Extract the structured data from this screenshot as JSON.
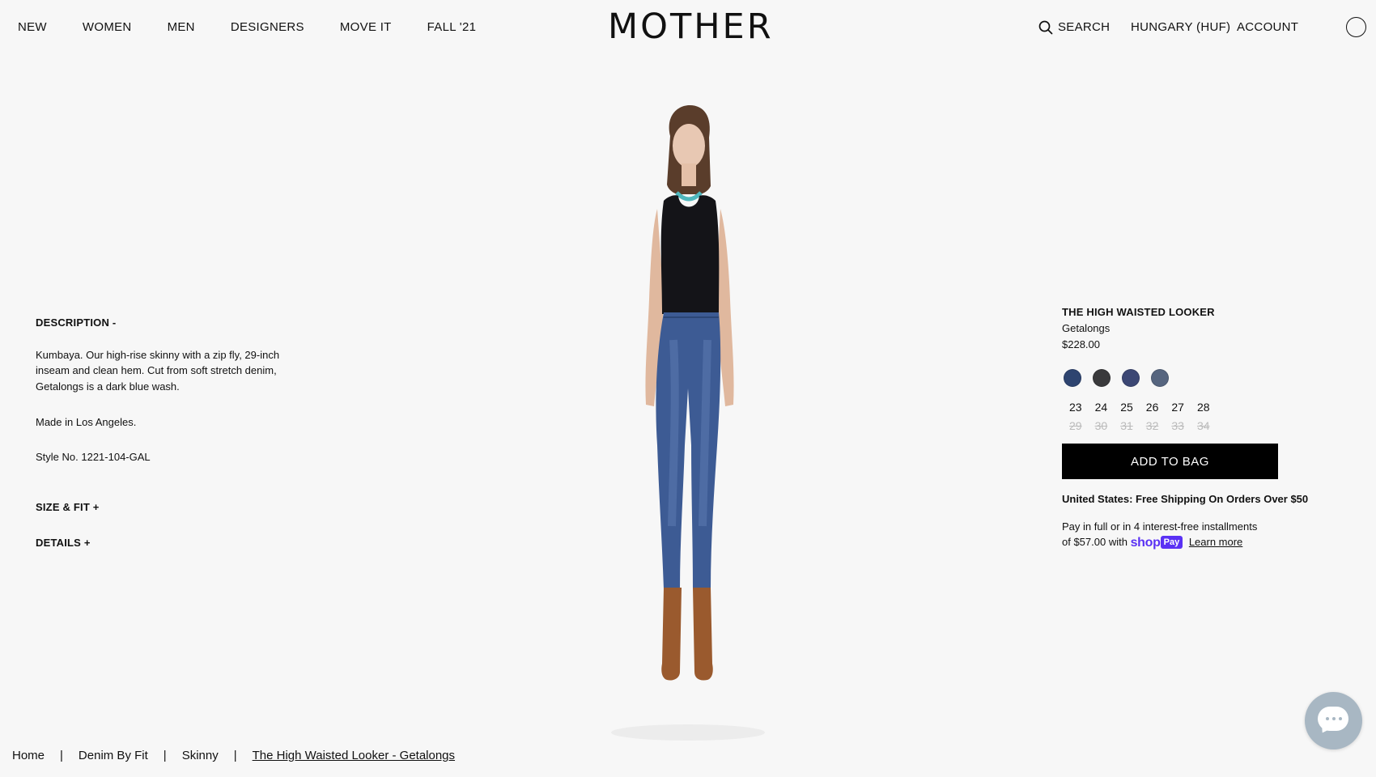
{
  "header": {
    "nav_left": [
      "NEW",
      "WOMEN",
      "MEN",
      "DESIGNERS",
      "MOVE IT",
      "FALL '21"
    ],
    "logo": "MOTHER",
    "search_label": "SEARCH",
    "region_label": "HUNGARY (HUF)",
    "account_label": "ACCOUNT",
    "cart_icon": "circle-bag-icon"
  },
  "description": {
    "heading": "DESCRIPTION -",
    "body": "Kumbaya. Our high-rise skinny with a zip fly, 29-inch inseam and clean hem. Cut from soft stretch denim, Getalongs is a dark blue wash.",
    "made_in": "Made in Los Angeles.",
    "style_no": "Style No. 1221-104-GAL",
    "size_fit_label": "SIZE & FIT +",
    "details_label": "DETAILS +"
  },
  "product": {
    "title": "THE HIGH WAISTED LOOKER",
    "wash": "Getalongs",
    "price": "$228.00",
    "swatches": [
      {
        "color": "#2e4470"
      },
      {
        "color": "#3a3a3c"
      },
      {
        "color": "#3c4774"
      },
      {
        "color": "#56657f"
      }
    ],
    "sizes_available": [
      "23",
      "24",
      "25",
      "26",
      "27",
      "28"
    ],
    "sizes_unavailable": [
      "29",
      "30",
      "31",
      "32",
      "33",
      "34"
    ],
    "add_to_bag_label": "ADD TO BAG",
    "shipping_text": "United States: Free Shipping On Orders Over $50",
    "installments_line1": "Pay in full or in 4 interest-free installments",
    "installments_prefix": "of $57.00 with",
    "shop_logo_text": "shop",
    "pay_badge_text": "Pay",
    "learn_more_label": "Learn more"
  },
  "breadcrumb": {
    "items": [
      "Home",
      "Denim By Fit",
      "Skinny"
    ],
    "separator": "|",
    "current": "The High Waisted Looker - Getalongs"
  },
  "colors": {
    "background": "#f7f7f7",
    "button": "#000000",
    "shop_pay": "#5a31f4",
    "chat": "#a8b7c3"
  }
}
